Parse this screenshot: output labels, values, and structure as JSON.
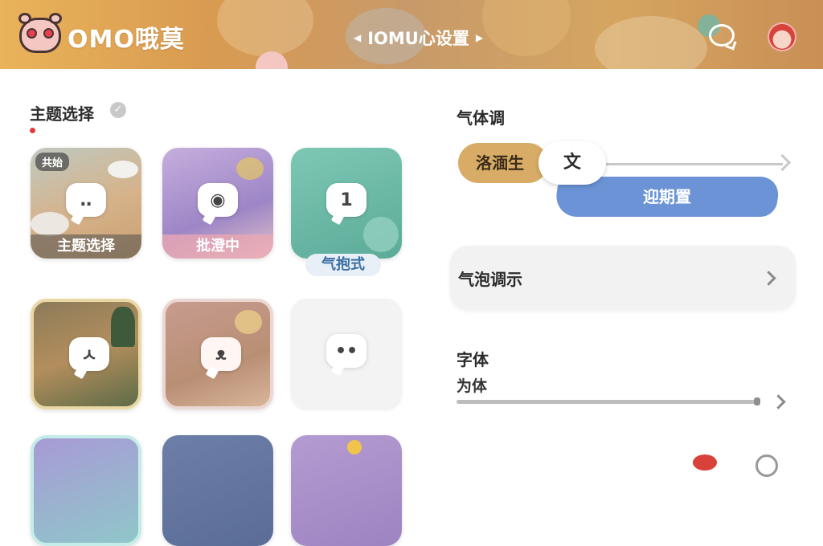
{
  "header": {
    "app_title": "OMO哦莫",
    "nav_title": "IOMU心设置",
    "nav_prev_icon": "caret-left-icon",
    "nav_next_icon": "caret-right-icon",
    "chat_icon": "chat-bubble-icon",
    "avatar_icon": "avatar-icon",
    "colors": {
      "banner": "#d99b51",
      "text": "#ffffff"
    }
  },
  "theme_section": {
    "title": "主题选择",
    "check_icon": "check-circle-icon",
    "tiles": [
      {
        "label": "主题选择",
        "badge": "共始",
        "icon": "chat-bubble-icon",
        "bg": "#c9b79a"
      },
      {
        "label": "批澄中",
        "icon": "eye-icon",
        "bg": "#a38fc9"
      },
      {
        "label": "气抱式",
        "bubble_text": "1",
        "bg": "#66b7a4"
      },
      {
        "icon": "chat-bubble-icon",
        "bubble_text": "ㅅ",
        "bg": "#8a7b5c"
      },
      {
        "icon": "bear-bubble-icon",
        "bg": "#d2a8a0"
      },
      {
        "icon": "cute-bubble-icon",
        "bg": "#f3f3f3"
      }
    ]
  },
  "bubble_section": {
    "title": "气体调",
    "pill_left": "洛湎生",
    "pill_mid": "文",
    "blue_brush": "迎期置"
  },
  "bubble_style_row": {
    "label": "气泡调示"
  },
  "font_section": {
    "title": "字体",
    "value": "为体",
    "slider_fraction": 0.99
  },
  "colors": {
    "accent_blue": "#6b93d6",
    "accent_gold": "#d8ac66",
    "red_dot": "#e23a3a"
  }
}
